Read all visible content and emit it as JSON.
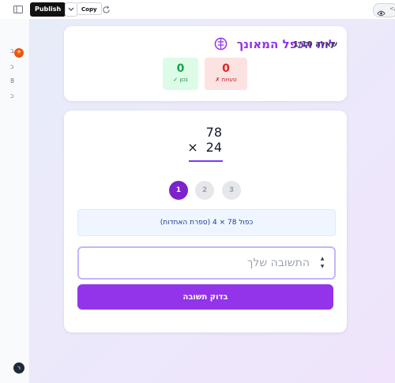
{
  "toolbar": {
    "publish_label": "Publish",
    "copy_label": "Copy",
    "view_suffix": "</"
  },
  "rail": {
    "add_label": "+",
    "glyphs": [
      "ב",
      "כ",
      "8",
      "כ"
    ],
    "avatar_label": "ר"
  },
  "header": {
    "title": "לוח הכפל המאונך",
    "question_counter": "שאלה 1/10",
    "wrong": {
      "count": "0",
      "label": "טעויות ✗"
    },
    "correct": {
      "count": "0",
      "label": "נכון ✓"
    }
  },
  "problem": {
    "multiplicand": "78",
    "operator": "×",
    "multiplier": "24"
  },
  "steps": [
    "1",
    "2",
    "3"
  ],
  "hint": "כפול 78 × 4 (ספרת האחדות)",
  "answer": {
    "placeholder": "התשובה שלך",
    "value": ""
  },
  "check_button": "בדוק תשובה",
  "colors": {
    "accent": "#9333ea",
    "wrong": "#dc2626",
    "correct": "#16a34a",
    "hint_bg": "#eff6ff"
  }
}
